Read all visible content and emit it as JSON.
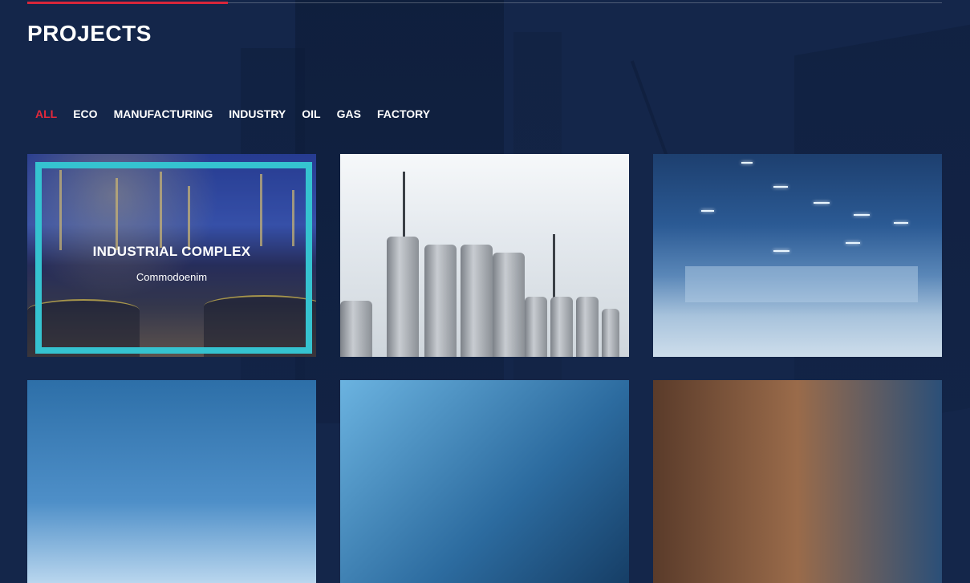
{
  "section": {
    "title": "PROJECTS"
  },
  "filters": [
    {
      "label": "ALL",
      "active": true
    },
    {
      "label": "ECO",
      "active": false
    },
    {
      "label": "MANUFACTURING",
      "active": false
    },
    {
      "label": "INDUSTRY",
      "active": false
    },
    {
      "label": "OIL",
      "active": false
    },
    {
      "label": "GAS",
      "active": false
    },
    {
      "label": "FACTORY",
      "active": false
    }
  ],
  "projects": [
    {
      "title": "INDUSTRIAL COMPLEX",
      "subtitle": "Commodoenim",
      "image": "refinery-night",
      "hovered": true
    },
    {
      "title": "",
      "subtitle": "",
      "image": "grain-silos",
      "hovered": false
    },
    {
      "title": "",
      "subtitle": "",
      "image": "warehouse-interior",
      "hovered": false
    },
    {
      "title": "",
      "subtitle": "",
      "image": "factory-hall",
      "hovered": false
    },
    {
      "title": "",
      "subtitle": "",
      "image": "glass-roof",
      "hovered": false
    },
    {
      "title": "",
      "subtitle": "",
      "image": "machinery",
      "hovered": false
    }
  ],
  "colors": {
    "background": "#14264a",
    "accent": "#e3283b",
    "frame": "#35c3d0",
    "text": "#ffffff"
  }
}
